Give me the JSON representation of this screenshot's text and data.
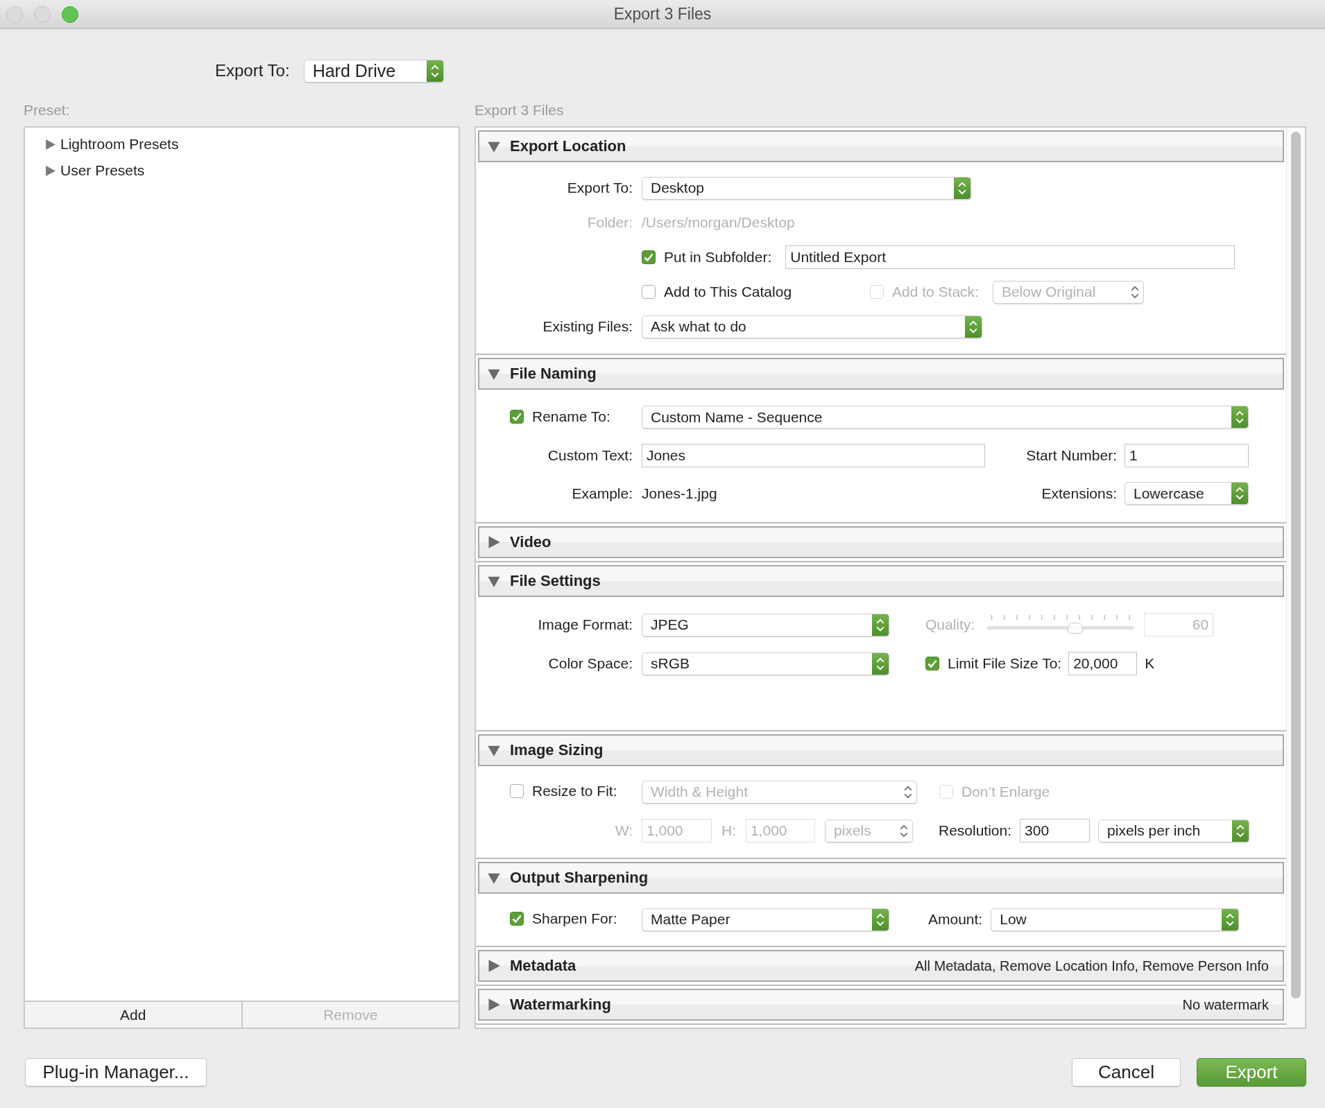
{
  "window": {
    "title": "Export 3 Files"
  },
  "export_to": {
    "label": "Export To:",
    "value": "Hard Drive"
  },
  "preset_panel": {
    "label": "Preset:",
    "items": [
      {
        "label": "Lightroom Presets",
        "expanded": false
      },
      {
        "label": "User Presets",
        "expanded": false
      }
    ],
    "buttons": [
      {
        "label": "Add",
        "disabled": false
      },
      {
        "label": "Remove",
        "disabled": true
      }
    ]
  },
  "settings": {
    "label": "Export 3 Files",
    "sections": [
      {
        "kind": "location",
        "title": "Export Location",
        "expanded": true,
        "export_to": {
          "label": "Export To:",
          "value": "Desktop"
        },
        "folder": {
          "label": "Folder:",
          "value": "/Users/morgan/Desktop",
          "disabled": true
        },
        "subfolder": {
          "label": "Put in Subfolder:",
          "checked": true
        },
        "subfolder_name": {
          "value": "Untitled Export"
        },
        "add_to_catalog": {
          "label": "Add to This Catalog",
          "checked": false
        },
        "add_to_stack": {
          "label": "Add to Stack:",
          "checked": false,
          "disabled": true
        },
        "stack_position": {
          "value": "Below Original",
          "disabled": true
        },
        "existing_files": {
          "label": "Existing Files:",
          "value": "Ask what to do"
        }
      },
      {
        "kind": "naming",
        "title": "File Naming",
        "expanded": true,
        "rename": {
          "label": "Rename To:",
          "checked": true
        },
        "template": {
          "value": "Custom Name - Sequence"
        },
        "custom_text": {
          "label": "Custom Text:",
          "value": "Jones"
        },
        "start_number": {
          "label": "Start Number:",
          "value": "1"
        },
        "example": {
          "label": "Example:",
          "value": "Jones-1.jpg"
        },
        "extensions": {
          "label": "Extensions:",
          "value": "Lowercase"
        }
      },
      {
        "title": "Video",
        "expanded": false
      },
      {
        "kind": "file_settings",
        "title": "File Settings",
        "expanded": true,
        "image_format": {
          "label": "Image Format:",
          "value": "JPEG"
        },
        "quality": {
          "label": "Quality:",
          "level": 0.6,
          "value": "60",
          "disabled": true
        },
        "color_space": {
          "label": "Color Space:",
          "value": "sRGB"
        },
        "limit_size": {
          "label": "Limit File Size To:",
          "checked": true
        },
        "limit_value": {
          "value": "20,000",
          "unit": "K"
        }
      },
      {
        "kind": "sizing",
        "title": "Image Sizing",
        "expanded": true,
        "resize": {
          "label": "Resize to Fit:",
          "checked": false
        },
        "resize_mode": {
          "value": "Width & Height",
          "disabled": true
        },
        "dont_enlarge": {
          "label": "Don’t Enlarge",
          "checked": false,
          "disabled": true
        },
        "width": {
          "label": "W:",
          "value": "1,000",
          "disabled": true
        },
        "height": {
          "label": "H:",
          "value": "1,000",
          "disabled": true
        },
        "size_units": {
          "value": "pixels",
          "disabled": true
        },
        "resolution": {
          "label": "Resolution:",
          "value": "300"
        },
        "resolution_units": {
          "value": "pixels per inch"
        }
      },
      {
        "kind": "sharpening",
        "title": "Output Sharpening",
        "expanded": true,
        "sharpen": {
          "label": "Sharpen For:",
          "checked": true
        },
        "sharpen_for": {
          "value": "Matte Paper"
        },
        "amount": {
          "label": "Amount:",
          "value": "Low"
        }
      },
      {
        "title": "Metadata",
        "expanded": false,
        "summary": "All Metadata, Remove Location Info, Remove Person Info"
      },
      {
        "title": "Watermarking",
        "expanded": false,
        "summary": "No watermark"
      }
    ]
  },
  "footer": {
    "plugin_manager": "Plug-in Manager...",
    "cancel": "Cancel",
    "export": "Export"
  }
}
